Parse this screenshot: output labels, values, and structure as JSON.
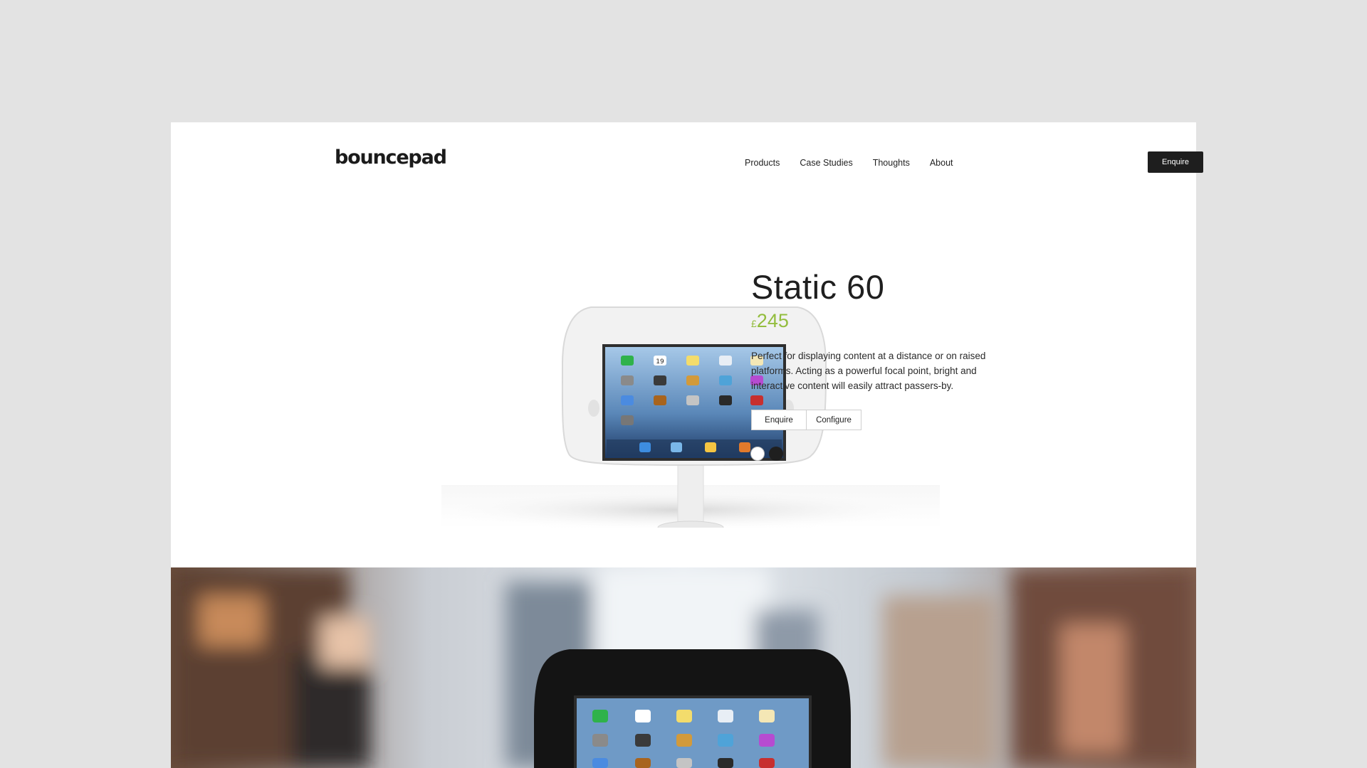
{
  "brand": {
    "logo": "bouncepad"
  },
  "nav": {
    "items": [
      "Products",
      "Case Studies",
      "Thoughts",
      "About"
    ],
    "cta": "Enquire"
  },
  "product": {
    "title": "Static 60",
    "currency": "£",
    "price": "245",
    "description": "Perfect for displaying content at a distance or on raised platforms. Acting as a powerful focal point, bright and interactive content will easily attract passers-by.",
    "buttons": {
      "enquire": "Enquire",
      "configure": "Configure"
    },
    "colors": [
      {
        "name": "white",
        "hex": "#ffffff"
      },
      {
        "name": "black",
        "hex": "#1f1f1f"
      }
    ],
    "screen_icons": [
      "19"
    ]
  },
  "colors": {
    "accent": "#93bd3e",
    "dark": "#1e1e1e",
    "background": "#e3e3e3"
  }
}
